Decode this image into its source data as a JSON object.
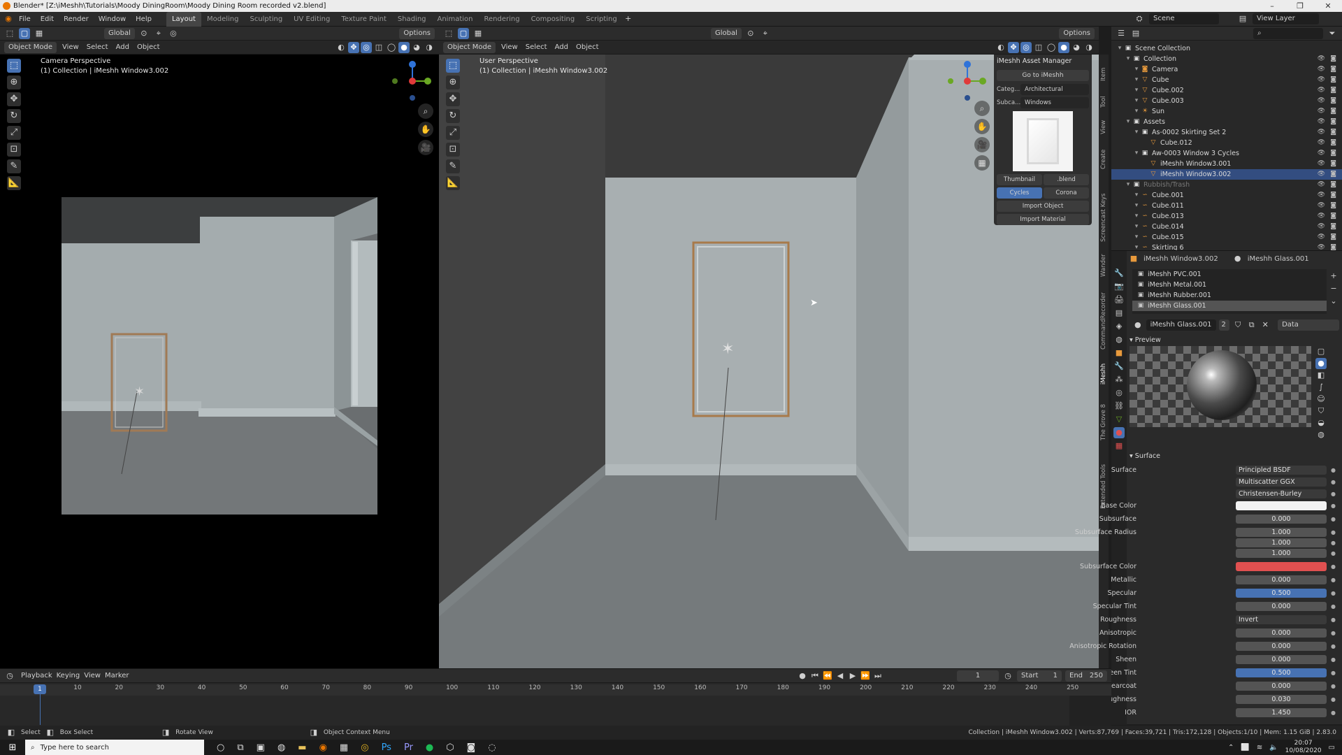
{
  "title": "Blender* [Z:\\iMeshh\\Tutorials\\Moody DiningRoom\\Moody Dining Room recorded v2.blend]",
  "menu": [
    "File",
    "Edit",
    "Render",
    "Window",
    "Help"
  ],
  "workspaces": [
    {
      "label": "Layout",
      "active": true
    },
    {
      "label": "Modeling"
    },
    {
      "label": "Sculpting"
    },
    {
      "label": "UV Editing"
    },
    {
      "label": "Texture Paint"
    },
    {
      "label": "Shading"
    },
    {
      "label": "Animation"
    },
    {
      "label": "Rendering"
    },
    {
      "label": "Compositing"
    },
    {
      "label": "Scripting"
    }
  ],
  "scene": "Scene",
  "view_layer": "View Layer",
  "toolheader": {
    "transform_orientation": "Global",
    "options": "Options"
  },
  "left_viewport": {
    "mode": "Object Mode",
    "menus": [
      "View",
      "Select",
      "Add",
      "Object"
    ],
    "overlay_title": "Camera Perspective",
    "overlay_sub": "(1) Collection | iMeshh Window3.002"
  },
  "right_viewport": {
    "mode": "Object Mode",
    "menus": [
      "View",
      "Select",
      "Add",
      "Object"
    ],
    "overlay_title": "User Perspective",
    "overlay_sub": "(1) Collection | iMeshh Window3.002",
    "orientation": "Global",
    "options": "Options"
  },
  "asset_manager": {
    "title": "iMeshh Asset Manager",
    "go_button": "Go to iMeshh",
    "category_label": "Categ...",
    "category_value": "Architectural",
    "subcategory_label": "Subca...",
    "subcategory_value": "Windows",
    "thumb_tab": "Thumbnail",
    "blend_tab": ".blend",
    "engine_cycles": "Cycles",
    "engine_corona": "Corona",
    "import_object": "Import Object",
    "import_material": "Import Material"
  },
  "side_tabs": [
    "Item",
    "Tool",
    "View",
    "Create",
    "Screencast Keys",
    "Wander",
    "CommandRecorder",
    "iMeshh",
    "The Grove 8",
    "Extended Tools"
  ],
  "outliner": {
    "rows": [
      {
        "name": "Scene Collection",
        "indent": 0,
        "icon": "collection-icon"
      },
      {
        "name": "Collection",
        "indent": 1,
        "icon": "collection-icon"
      },
      {
        "name": "Camera",
        "indent": 2,
        "icon": "camera-icon"
      },
      {
        "name": "Cube",
        "indent": 2,
        "icon": "object-icon"
      },
      {
        "name": "Cube.002",
        "indent": 2,
        "icon": "object-icon"
      },
      {
        "name": "Cube.003",
        "indent": 2,
        "icon": "object-icon"
      },
      {
        "name": "Sun",
        "indent": 2,
        "icon": "light-icon"
      },
      {
        "name": "Assets",
        "indent": 1,
        "icon": "collection-icon"
      },
      {
        "name": "As-0002 Skirting Set 2",
        "indent": 2,
        "icon": "collection-icon"
      },
      {
        "name": "Cube.012",
        "indent": 3,
        "icon": "object-icon"
      },
      {
        "name": "Aw-0003 Window 3 Cycles",
        "indent": 2,
        "icon": "collection-icon"
      },
      {
        "name": "iMeshh Window3.001",
        "indent": 3,
        "icon": "object-icon"
      },
      {
        "name": "iMeshh Window3.002",
        "indent": 3,
        "icon": "object-icon",
        "selected": true
      },
      {
        "name": "Rubbish/Trash",
        "indent": 1,
        "icon": "collection-icon",
        "dim": true
      },
      {
        "name": "Cube.001",
        "indent": 2,
        "icon": "curve-icon"
      },
      {
        "name": "Cube.011",
        "indent": 2,
        "icon": "curve-icon"
      },
      {
        "name": "Cube.013",
        "indent": 2,
        "icon": "curve-icon"
      },
      {
        "name": "Cube.014",
        "indent": 2,
        "icon": "curve-icon"
      },
      {
        "name": "Cube.015",
        "indent": 2,
        "icon": "curve-icon"
      },
      {
        "name": "Skirting 6",
        "indent": 2,
        "icon": "curve-icon"
      }
    ]
  },
  "properties": {
    "object_name": "iMeshh Window3.002",
    "material_name": "iMeshh Glass.001",
    "slots": [
      "iMeshh PVC.001",
      "iMeshh Metal.001",
      "iMeshh Rubber.001",
      "iMeshh Glass.001"
    ],
    "material_field": "iMeshh Glass.001",
    "users": "2",
    "link": "Data",
    "preview_label": "Preview",
    "surface_label": "Surface",
    "rows": [
      {
        "label": "Surface",
        "value": "Principled BSDF",
        "kind": "left"
      },
      {
        "label": "",
        "value": "Multiscatter GGX",
        "kind": "left"
      },
      {
        "label": "",
        "value": "Christensen-Burley",
        "kind": "left"
      },
      {
        "label": "Base Color",
        "value": "",
        "kind": "color",
        "color": "#f2f2f2"
      },
      {
        "label": "Subsurface",
        "value": "0.000"
      },
      {
        "label": "Subsurface Radius",
        "value": "1.000"
      },
      {
        "label": "",
        "value": "1.000"
      },
      {
        "label": "",
        "value": "1.000"
      },
      {
        "label": "Subsurface Color",
        "value": "",
        "kind": "color",
        "color": "#e05050"
      },
      {
        "label": "Metallic",
        "value": "0.000"
      },
      {
        "label": "Specular",
        "value": "0.500",
        "kind": "blue"
      },
      {
        "label": "Specular Tint",
        "value": "0.000"
      },
      {
        "label": "Roughness",
        "value": "Invert",
        "kind": "left"
      },
      {
        "label": "Anisotropic",
        "value": "0.000"
      },
      {
        "label": "Anisotropic Rotation",
        "value": "0.000"
      },
      {
        "label": "Sheen",
        "value": "0.000"
      },
      {
        "label": "Sheen Tint",
        "value": "0.500",
        "kind": "blue"
      },
      {
        "label": "Clearcoat",
        "value": "0.000"
      },
      {
        "label": "Clearcoat Roughness",
        "value": "0.030"
      },
      {
        "label": "IOR",
        "value": "1.450"
      }
    ]
  },
  "timeline": {
    "menus": [
      "Playback",
      "Keying",
      "View",
      "Marker"
    ],
    "current": "1",
    "start_label": "Start",
    "start": "1",
    "end_label": "End",
    "end": "250",
    "ticks": [
      "1",
      "10",
      "20",
      "30",
      "40",
      "50",
      "60",
      "70",
      "80",
      "90",
      "100",
      "110",
      "120",
      "130",
      "140",
      "150",
      "160",
      "170",
      "180",
      "190",
      "200",
      "210",
      "220",
      "230",
      "240",
      "250"
    ]
  },
  "statusbar": {
    "select": "Select",
    "box_select": "Box Select",
    "rotate": "Rotate View",
    "context": "Object Context Menu",
    "stats": "Collection | iMeshh Window3.002 | Verts:87,769 | Faces:39,721 | Tris:172,128 | Objects:1/10 | Mem: 1.15 GiB | 2.83.0"
  },
  "taskbar": {
    "search_placeholder": "Type here to search",
    "time": "20:07",
    "date": "10/08/2020"
  }
}
